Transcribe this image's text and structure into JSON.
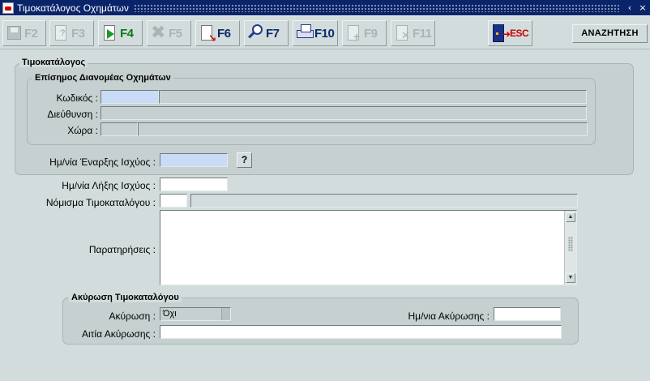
{
  "window": {
    "title": "Τιμοκατάλογος Οχημάτων",
    "minimize": "‹",
    "close": "×"
  },
  "toolbar": {
    "buttons": [
      {
        "key": "F2",
        "icon": "save-icon",
        "enabled": false
      },
      {
        "key": "F3",
        "icon": "help-doc-icon",
        "enabled": false
      },
      {
        "key": "F4",
        "icon": "new-record-icon",
        "enabled": true
      },
      {
        "key": "F5",
        "icon": "delete-icon",
        "enabled": false
      },
      {
        "key": "F6",
        "icon": "clear-doc-icon",
        "enabled": true
      },
      {
        "key": "F7",
        "icon": "search-icon",
        "enabled": true
      },
      {
        "key": "F10",
        "icon": "print-icon",
        "enabled": true
      },
      {
        "key": "F9",
        "icon": "add-doc-icon",
        "enabled": false
      },
      {
        "key": "F11",
        "icon": "remove-doc-icon",
        "enabled": false
      },
      {
        "key": "ESC",
        "icon": "exit-door-icon",
        "enabled": true
      }
    ],
    "mode_label": "ΑΝΑΖΗΤΗΣΗ"
  },
  "price_list": {
    "group_title": "Τιμοκατάλογος",
    "distributor": {
      "group_title": "Επίσημος Διανομέας Οχημάτων",
      "code_label": "Κωδικός :",
      "code_value": "",
      "code_name": "",
      "address_label": "Διεύθυνση :",
      "address_value": "",
      "country_label": "Χώρα :",
      "country_code": "",
      "country_name": ""
    },
    "start_date_label": "Ημ/νία Έναρξης Ισχύος :",
    "start_date_value": "",
    "lov_button": "?"
  },
  "end_date_label": "Ημ/νία Λήξης Ισχύος :",
  "end_date_value": "",
  "currency_label": "Νόμισμα Τιμοκαταλόγου :",
  "currency_code": "",
  "currency_name": "",
  "remarks_label": "Παρατηρήσεις :",
  "remarks_value": "",
  "cancellation": {
    "group_title": "Ακύρωση Τιμοκαταλόγου",
    "cancel_label": "Ακύρωση :",
    "cancel_value": "Όχι",
    "cancel_date_label": "Ημ/νια Ακύρωσης :",
    "cancel_date_value": "",
    "reason_label": "Αιτία Ακύρωσης :",
    "reason_value": ""
  },
  "colors": {
    "titlebar": "#0a246a",
    "background": "#d3dcdc",
    "focus_field": "#c8dcf8",
    "exit_red": "#cc0000"
  }
}
